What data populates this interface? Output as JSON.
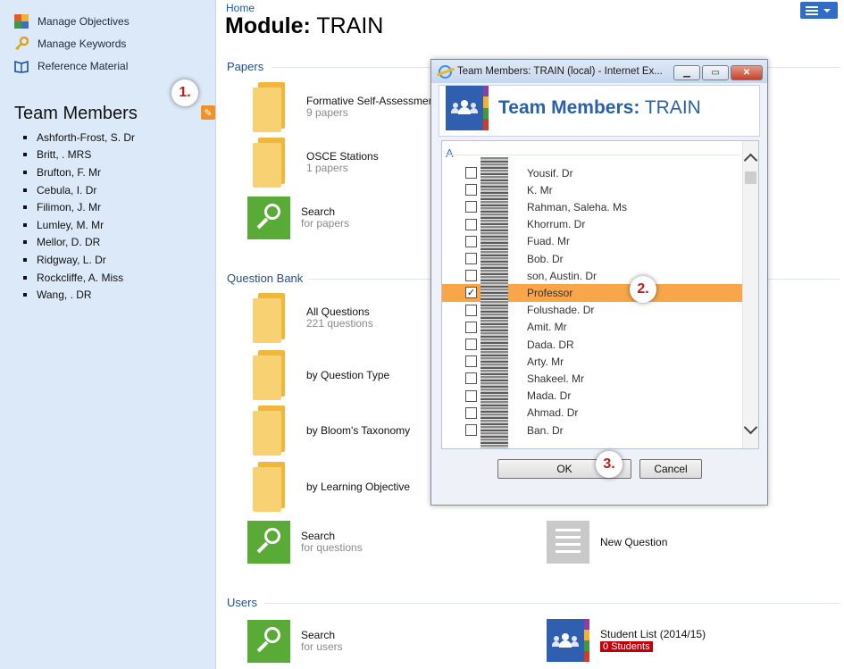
{
  "sidebar": {
    "links": [
      {
        "label": "Manage Objectives",
        "icon": "objectives-grid-icon"
      },
      {
        "label": "Manage Keywords",
        "icon": "key-icon"
      },
      {
        "label": "Reference Material",
        "icon": "book-icon"
      }
    ],
    "team_title": "Team Members",
    "members": [
      "Ashforth-Frost, S. Dr",
      "Britt, . MRS",
      "Brufton, F. Mr",
      "Cebula, I. Dr",
      "Filimon, J. Mr",
      "Lumley, M. Mr",
      "Mellor, D. DR",
      "Ridgway, L. Dr",
      "Rockcliffe, A. Miss",
      "Wang, . DR"
    ]
  },
  "callouts": {
    "one": "1.",
    "two": "2.",
    "three": "3."
  },
  "header": {
    "breadcrumb": "Home",
    "title_prefix": "Module:",
    "title_module": "TRAIN"
  },
  "sections": {
    "papers": "Papers",
    "question_bank": "Question Bank",
    "users": "Users"
  },
  "papers": {
    "formative": {
      "title": "Formative Self-Assessments",
      "sub": "9 papers"
    },
    "osce": {
      "title": "OSCE Stations",
      "sub": "1 papers"
    },
    "search": {
      "title": "Search",
      "sub": "for papers"
    }
  },
  "question_bank": {
    "all": {
      "title": "All Questions",
      "sub": "221 questions"
    },
    "by_type": {
      "title": "by Question Type"
    },
    "by_bloom": {
      "title": "by Bloom's Taxonomy"
    },
    "by_objective": {
      "title": "by Learning Objective"
    },
    "search": {
      "title": "Search",
      "sub": "for questions"
    },
    "new_question": {
      "title": "New Question"
    }
  },
  "users": {
    "search": {
      "title": "Search",
      "sub": "for users"
    },
    "student_list": {
      "title": "Student List (2014/15)",
      "badge": "0 Students"
    }
  },
  "dialog": {
    "window_title": "Team Members: TRAIN (local) - Internet Ex...",
    "heading_prefix": "Team Members:",
    "heading_module": "TRAIN",
    "group_letter": "A",
    "rows": [
      {
        "name": "Yousif. Dr",
        "checked": false
      },
      {
        "name": "K. Mr",
        "checked": false
      },
      {
        "name": "Rahman, Saleha. Ms",
        "checked": false
      },
      {
        "name": "Khorrum. Dr",
        "checked": false
      },
      {
        "name": "Fuad. Mr",
        "checked": false
      },
      {
        "name": "Bob. Dr",
        "checked": false
      },
      {
        "name": "son, Austin. Dr",
        "checked": false
      },
      {
        "name": "Professor",
        "checked": true
      },
      {
        "name": "Folushade. Dr",
        "checked": false
      },
      {
        "name": "Amit. Mr",
        "checked": false
      },
      {
        "name": "Dada. DR",
        "checked": false
      },
      {
        "name": "Arty. Mr",
        "checked": false
      },
      {
        "name": "Shakeel. Mr",
        "checked": false
      },
      {
        "name": "Mada. Dr",
        "checked": false
      },
      {
        "name": "Ahmad. Dr",
        "checked": false
      },
      {
        "name": "Ban. Dr",
        "checked": false
      }
    ],
    "ok_label": "OK",
    "cancel_label": "Cancel",
    "checkmark": "✓"
  },
  "colors": {
    "sidebar_bg": "#dce9f8",
    "accent_blue": "#2f5fae",
    "section_blue": "#1e4f8c",
    "search_green": "#5aaa37",
    "folder_yellow": "#f8d272",
    "edit_orange": "#f29224",
    "checked_row": "#f9a64b",
    "badge_red": "#c0000b"
  }
}
